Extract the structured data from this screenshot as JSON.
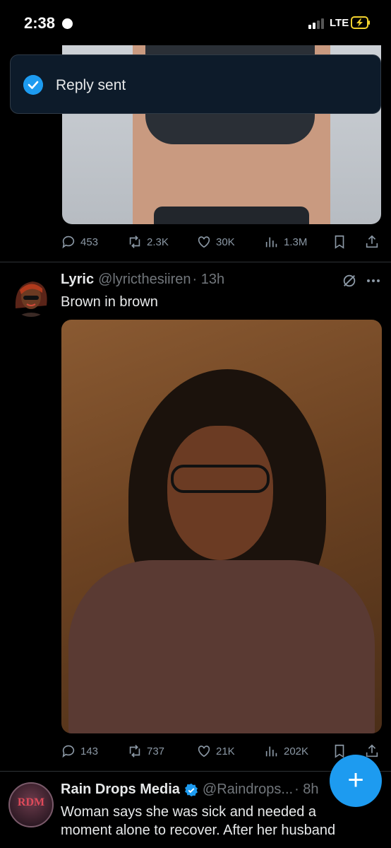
{
  "status_bar": {
    "time": "2:38",
    "network": "LTE"
  },
  "toast": {
    "text": "Reply sent"
  },
  "tweet1": {
    "stats": {
      "replies": "453",
      "reposts": "2.3K",
      "likes": "30K",
      "views": "1.3M"
    }
  },
  "tweet2": {
    "name": "Lyric",
    "handle": "@lyricthesiiren",
    "time": "· 13h",
    "text": "Brown in brown",
    "stats": {
      "replies": "143",
      "reposts": "737",
      "likes": "21K",
      "views": "202K"
    }
  },
  "tweet3": {
    "name": "Rain Drops Media",
    "avatar_text": "RDM",
    "handle": "@Raindrops...",
    "time": "· 8h",
    "text_line1": "Woman says she was sick and needed a",
    "text_line2": "moment alone to recover. After her husband"
  },
  "colors": {
    "accent": "#1d9bf0",
    "background": "#000000",
    "muted": "#71767b"
  }
}
